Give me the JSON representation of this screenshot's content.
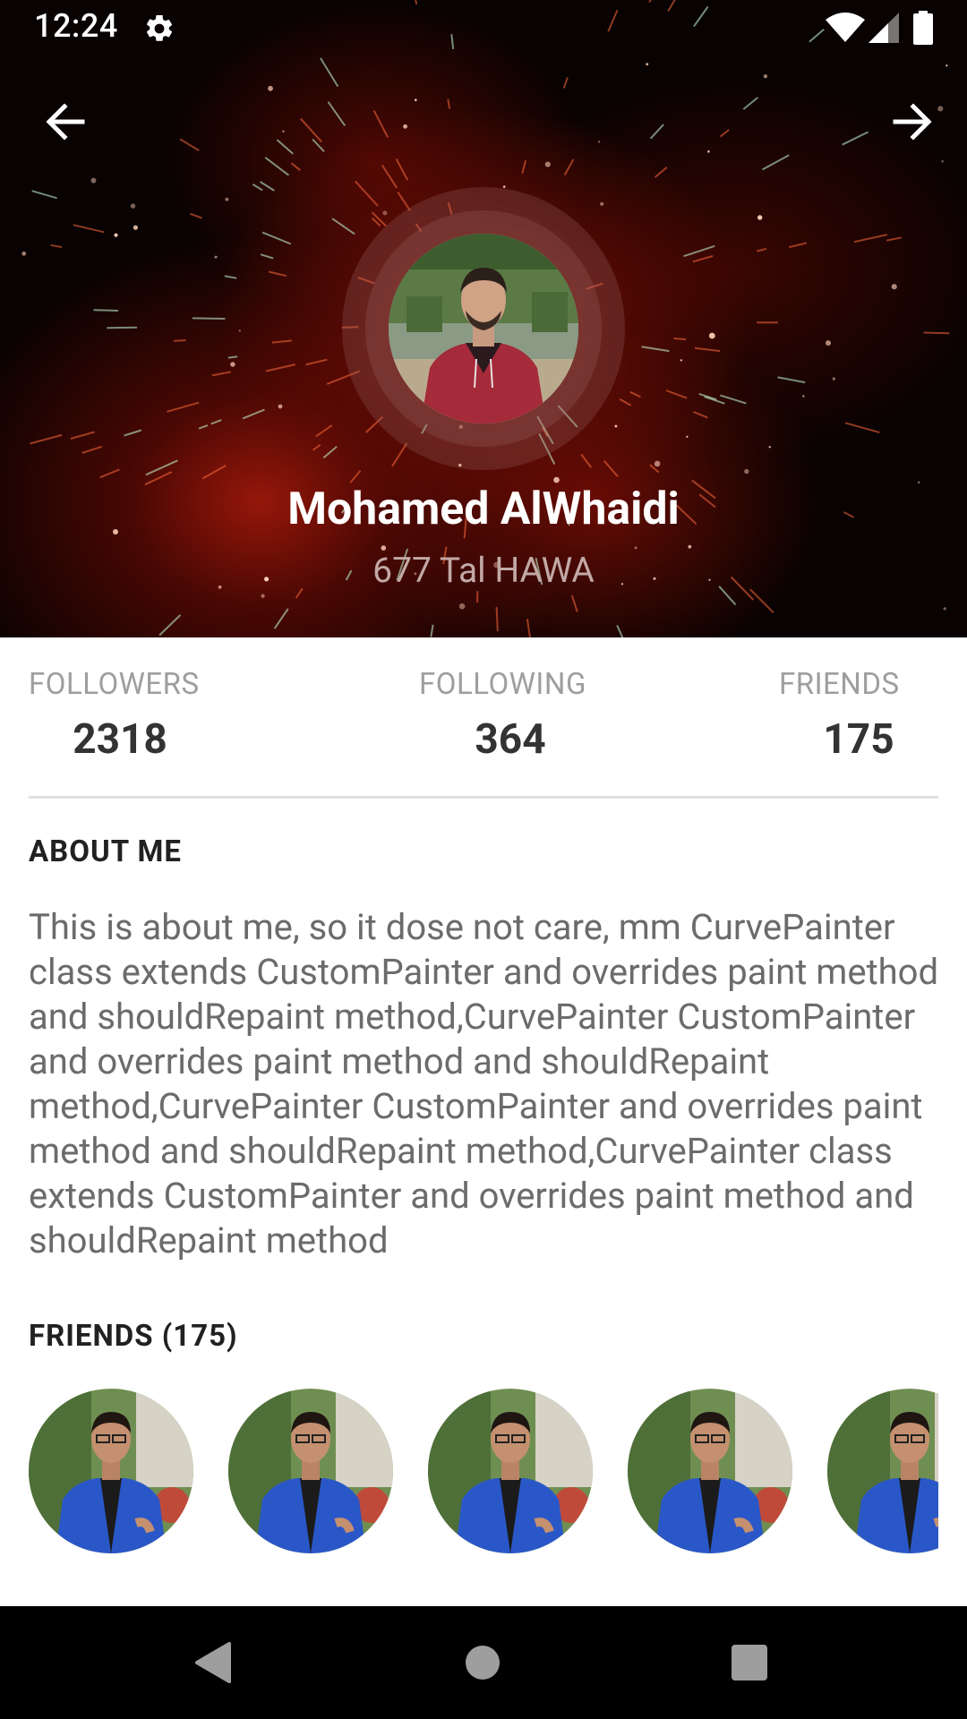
{
  "status_bar": {
    "time": "12:24",
    "icons": [
      "gear-icon",
      "wifi-icon",
      "cell-signal-icon",
      "battery-icon"
    ]
  },
  "header": {
    "back_icon": "arrow-left-icon",
    "forward_icon": "arrow-right-icon",
    "name": "Mohamed AlWhaidi",
    "location": "677 Tal HAWA"
  },
  "stats": {
    "followers": {
      "label": "FOLLOWERS",
      "value": "2318"
    },
    "following": {
      "label": "FOLLOWING",
      "value": "364"
    },
    "friends": {
      "label": "FRIENDS",
      "value": "175"
    }
  },
  "about": {
    "title": "ABOUT ME",
    "text": "This is about me, so it dose not care, mm CurvePainter class extends CustomPainter and overrides paint method and shouldRepaint method,CurvePainter CustomPainter and overrides paint method and shouldRepaint method,CurvePainter CustomPainter and overrides paint method and shouldRepaint method,CurvePainter class extends CustomPainter and overrides paint method and shouldRepaint method"
  },
  "friends": {
    "title": "FRIENDS (175)",
    "avatars": [
      "friend-photo",
      "friend-photo",
      "friend-photo",
      "friend-photo",
      "friend-photo"
    ]
  },
  "nav_bar": {
    "icons": [
      "back-triangle-icon",
      "home-circle-icon",
      "recents-square-icon"
    ]
  },
  "colors": {
    "header_bg": "#080202",
    "header_glow": "#8a1206",
    "name_text": "#ffffff",
    "location_text": "#c2a9a6",
    "stat_label": "#9e9e9e",
    "stat_value": "#333333",
    "body_text": "#6b6b6b",
    "section_title": "#212121",
    "divider": "#e0e0e0",
    "nav_bar_bg": "#000000"
  }
}
